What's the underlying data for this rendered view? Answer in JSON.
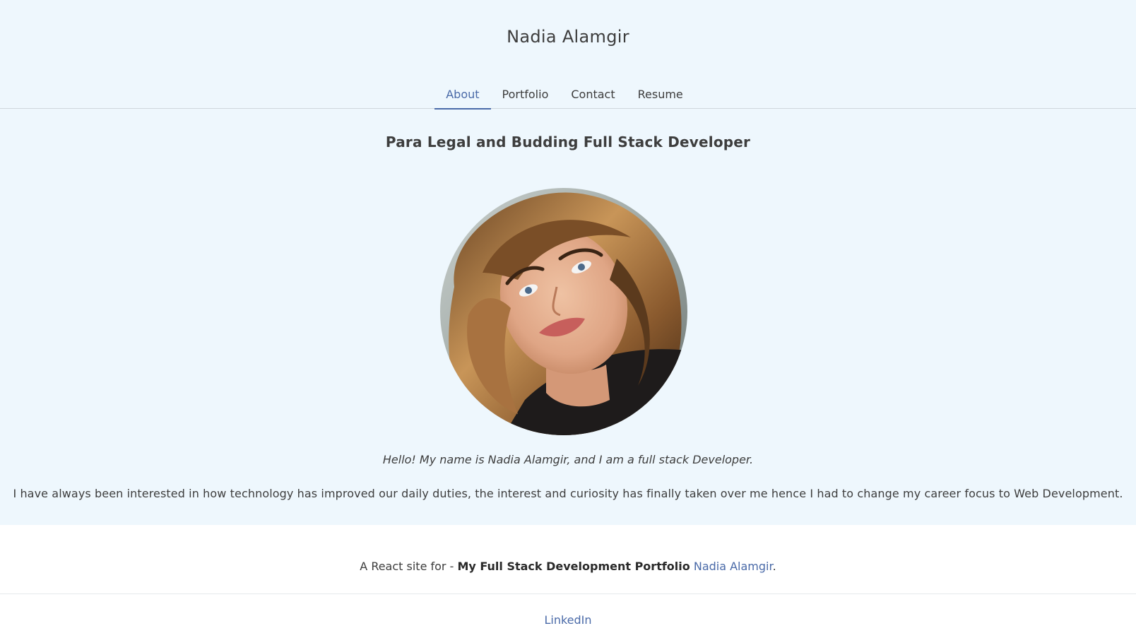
{
  "header": {
    "site_title": "Nadia Alamgir"
  },
  "nav": {
    "items": [
      {
        "label": "About",
        "active": true
      },
      {
        "label": "Portfolio",
        "active": false
      },
      {
        "label": "Contact",
        "active": false
      },
      {
        "label": "Resume",
        "active": false
      }
    ]
  },
  "about": {
    "subtitle": "Para Legal and Budding Full Stack Developer",
    "intro": "Hello! My name is Nadia Alamgir, and I am a full stack Developer.",
    "bio": "I have always been interested in how technology has improved our daily duties, the interest and curiosity has finally taken over me hence I had to change my career focus to Web Development."
  },
  "footer": {
    "prefix": "A React site for - ",
    "project": "My Full Stack Development Portfolio",
    "author_link": "Nadia Alamgir",
    "suffix": ".",
    "linkedin": "LinkedIn"
  },
  "colors": {
    "background": "#eef7fd",
    "accent": "#4a6aa8",
    "text": "#3d3d3d"
  }
}
